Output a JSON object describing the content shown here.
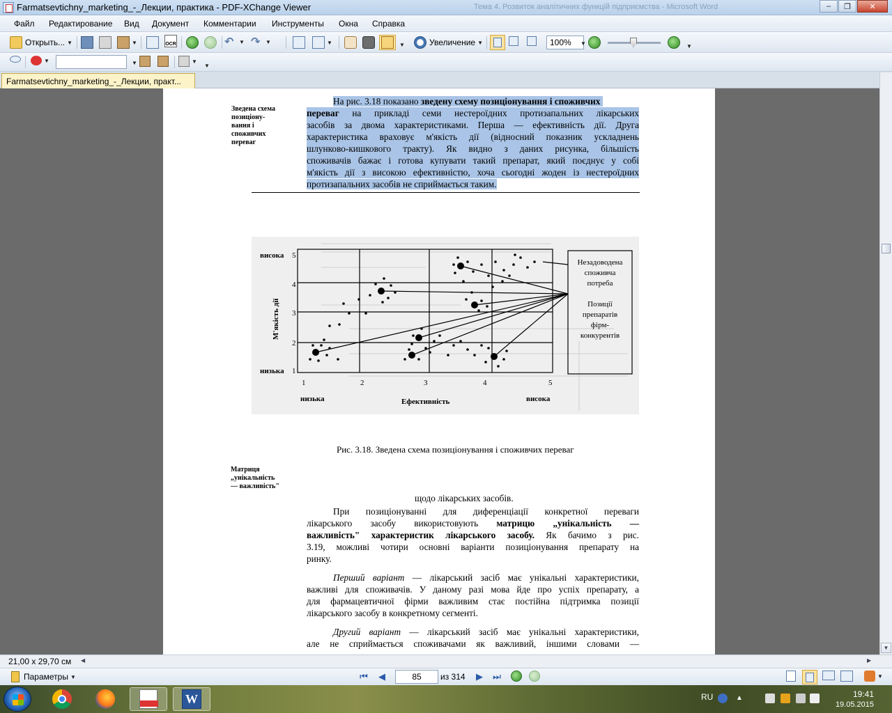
{
  "window": {
    "title": "Farmatsevtichny_marketing_-_Лекции, практика - PDF-XChange Viewer",
    "ghost_text": "Тема 4. Розвиток аналітичних функцій підприємства - Microsoft Word"
  },
  "menu": [
    "Файл",
    "Редактирование",
    "Вид",
    "Документ",
    "Комментарии",
    "Инструменты",
    "Окна",
    "Справка"
  ],
  "toolbar": {
    "open_label": "Открыть...",
    "zoom_label": "Увеличение",
    "zoom_value": "100%",
    "ocr_label": "OCR"
  },
  "tab": {
    "label": "Farmatsevtichny_marketing_-_Лекции, практ..."
  },
  "document": {
    "margin_note_1": [
      "Зведена схема",
      "позиціону-",
      "вання і",
      "споживчих",
      "переваг"
    ],
    "para1_lines": [
      "На рис. 3.18 показано зведену схему позиціонування і споживчих",
      "переваг на прикладі семи нестероїдних протизапальних лікарських",
      "засобів за двома характеристиками. Перша — ефективність дії. Друга",
      "характеристика враховує м'якість дії (відносний показник ускладнень",
      "шлунково-кишкового тракту). Як видно з даних рисунка, більшість",
      "споживачів бажає і готова купувати такий препарат, який поєднує у собі",
      "м'якість дії з високою ефективністю, хоча сьогодні жоден із нестероїдних",
      "протизапальних засобів не сприймається таким."
    ],
    "figure": {
      "y_title": "М'якість дії",
      "y_high": "висока",
      "y_low": "низька",
      "y_ticks": [
        "5",
        "4",
        "3",
        "2",
        "1"
      ],
      "x_ticks": [
        "1",
        "2",
        "3",
        "4",
        "5"
      ],
      "x_title": "Ефективність",
      "x_low": "низька",
      "x_high": "висока",
      "box_top": [
        "Незадоводена",
        "споживча",
        "потреба"
      ],
      "box_bottom": [
        "Позиції",
        "препаратів",
        "фірм-",
        "конкурентів"
      ]
    },
    "caption": "Рис. 3.18. Зведена схема позиціонування    і споживчих переваг",
    "margin_note_2": [
      "Матриця",
      "„унікальність",
      "— важливість\""
    ],
    "line_after_caption": "щодо лікарських засобів.",
    "para2_lines": [
      "При позиціонуванні для диференціації конкретної переваги",
      "лікарського засобу використовують матрицю „унікальність —",
      "важливість\" характеристик лікарського засобу. Як бачимо з рис.",
      "3.19, можливі чотири основні варіанти позиціонування препарату на",
      "ринку."
    ],
    "para3_lines": [
      "Перший варіант — лікарський засіб має унікальні характеристики,",
      "важливі для споживачів. У даному разі мова йде про успіх препарату, а",
      "для фармацевтичної фірми важливим стає постійна підтримка позиції",
      "лікарського засобу в конкретному сегменті."
    ],
    "para4_lines": [
      "Другий варіант — лікарський засіб має унікальні характеристики,",
      "але не сприймається споживачами як важливий, іншими словами —"
    ]
  },
  "hscroll": {
    "dims": "21,00 x 29,70 см"
  },
  "status": {
    "params_label": "Параметры",
    "page_current": "85",
    "page_total": "из 314"
  },
  "taskbar": {
    "lang": "RU",
    "time": "19:41",
    "date": "19.05.2015"
  }
}
